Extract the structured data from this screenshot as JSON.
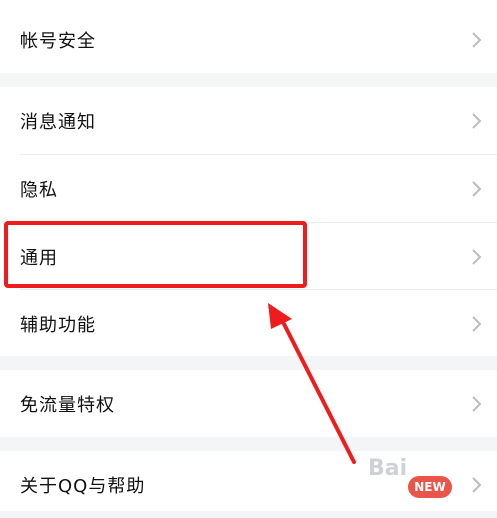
{
  "settings": {
    "items": [
      {
        "label": "帐号安全"
      },
      {
        "label": "消息通知"
      },
      {
        "label": "隐私"
      },
      {
        "label": "通用"
      },
      {
        "label": "辅助功能"
      },
      {
        "label": "免流量特权"
      },
      {
        "label": "关于QQ与帮助"
      }
    ]
  },
  "colors": {
    "highlight": "#ee1c1c",
    "background": "#f4f5f7",
    "card": "#ffffff"
  },
  "watermark": {
    "logo_text": "Bai",
    "badge_text": "NEW"
  }
}
